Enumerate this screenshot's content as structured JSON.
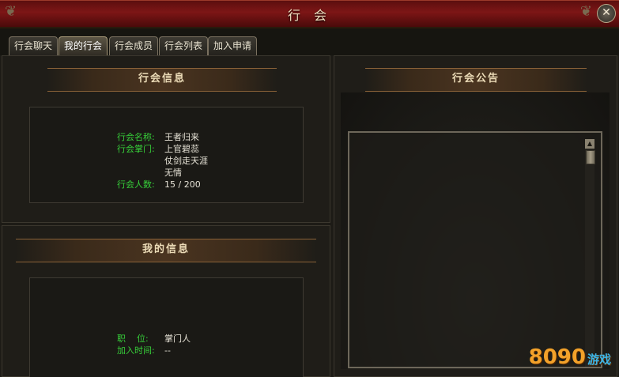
{
  "window": {
    "title": "行 会",
    "close_label": "✕"
  },
  "tabs": [
    {
      "label": "行会聊天",
      "active": false
    },
    {
      "label": "我的行会",
      "active": true
    },
    {
      "label": "行会成员",
      "active": false
    },
    {
      "label": "行会列表",
      "active": false
    },
    {
      "label": "加入申请",
      "active": false
    }
  ],
  "guild_info": {
    "header": "行会信息",
    "name_label": "行会名称:",
    "name_value": "王者归来",
    "leader_label": "行会掌门:",
    "leaders": [
      "上官碧蕊",
      "仗剑走天涯",
      "无情"
    ],
    "count_label": "行会人数:",
    "count_value": "15 / 200"
  },
  "my_info": {
    "header": "我的信息",
    "position_label": "职    位:",
    "position_value": "掌门人",
    "join_label": "加入时间:",
    "join_value": "--"
  },
  "notice": {
    "header": "行会公告",
    "content": ""
  },
  "watermark": {
    "brand": "8090",
    "game": "游戏"
  },
  "colors": {
    "title_bar": "#7d1616",
    "label_green": "#37d13a",
    "value_text": "#e6e2d6",
    "header_text": "#ecdcb8"
  }
}
